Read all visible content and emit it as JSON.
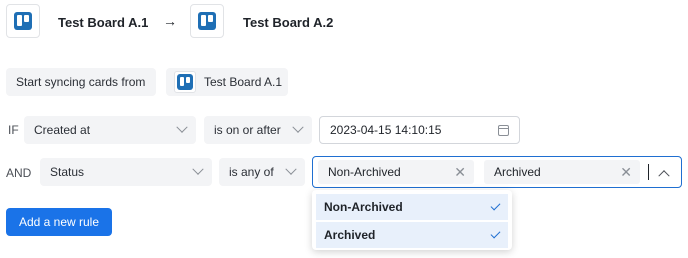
{
  "header": {
    "source_board": "Test Board A.1",
    "arrow": "→",
    "target_board": "Test Board A.2"
  },
  "sync": {
    "label": "Start syncing cards from",
    "board": "Test Board A.1"
  },
  "rules": [
    {
      "keyword": "IF",
      "field": "Created at",
      "operator": "is on or after",
      "value": "2023-04-15 14:10:15"
    },
    {
      "keyword": "AND",
      "field": "Status",
      "operator": "is any of",
      "selected_tags": [
        "Non-Archived",
        "Archived"
      ]
    }
  ],
  "dropdown": {
    "options": [
      {
        "label": "Non-Archived",
        "checked": true
      },
      {
        "label": "Archived",
        "checked": true
      }
    ]
  },
  "add_rule_button": "Add a new rule",
  "colors": {
    "accent": "#1a73e8",
    "trello": "#1f6fb5",
    "selected_option_bg": "#e8f0fb"
  }
}
